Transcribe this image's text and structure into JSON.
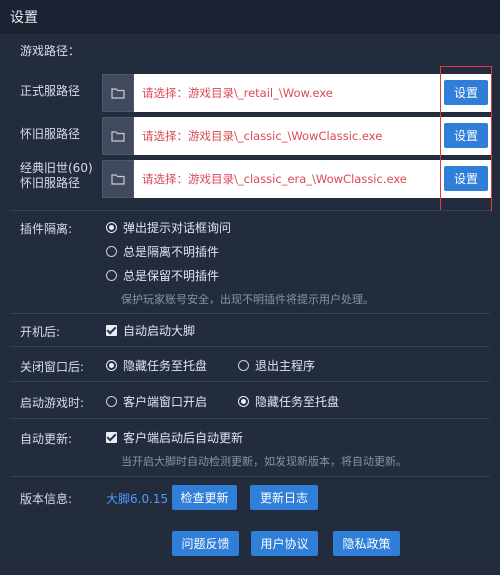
{
  "window": {
    "title": "设置"
  },
  "game_path": {
    "heading": "游戏路径："
  },
  "paths": [
    {
      "label": "正式服路径",
      "placeholder": "请选择：游戏目录\\_retail_\\Wow.exe",
      "button": "设置"
    },
    {
      "label": "怀旧服路径",
      "placeholder": "请选择：游戏目录\\_classic_\\WowClassic.exe",
      "button": "设置"
    },
    {
      "label_line1": "经典旧世(60)",
      "label_line2": "怀旧服路径",
      "placeholder": "请选择：游戏目录\\_classic_era_\\WowClassic.exe",
      "button": "设置"
    }
  ],
  "plugin_isolation": {
    "label": "插件隔离:",
    "options": [
      "弹出提示对话框询问",
      "总是隔离不明插件",
      "总是保留不明插件"
    ],
    "selected": 0,
    "hint": "保护玩家账号安全，出现不明插件将提示用户处理。"
  },
  "startup": {
    "label": "开机后:",
    "option": "自动启动大脚",
    "checked": true
  },
  "close_window": {
    "label": "关闭窗口后:",
    "options": [
      "隐藏任务至托盘",
      "退出主程序"
    ],
    "selected": 0
  },
  "launch_game": {
    "label": "启动游戏时:",
    "options": [
      "客户端窗口开启",
      "隐藏任务至托盘"
    ],
    "selected": 1
  },
  "auto_update": {
    "label": "自动更新:",
    "option": "客户端启动后自动更新",
    "checked": true,
    "hint": "当开启大脚时自动检测更新，如发现新版本，将自动更新。"
  },
  "version_info": {
    "label": "版本信息:",
    "version": "大脚6.0.15",
    "check_update": "检查更新",
    "changelog": "更新日志"
  },
  "footer": {
    "feedback": "问题反馈",
    "user_agreement": "用户协议",
    "privacy": "隐私政策"
  },
  "colors": {
    "accent": "#2f7ed8",
    "placeholder_text": "#d94a55",
    "highlight": "#e53a3a",
    "version_link": "#4e9bff"
  }
}
